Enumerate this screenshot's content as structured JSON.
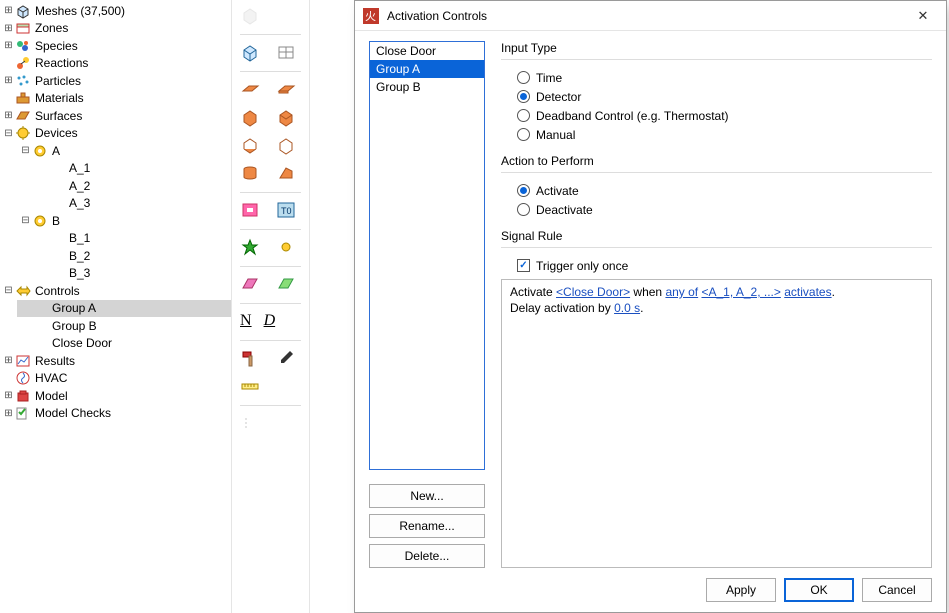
{
  "tree": {
    "meshes": "Meshes (37,500)",
    "zones": "Zones",
    "species": "Species",
    "reactions": "Reactions",
    "particles": "Particles",
    "materials": "Materials",
    "surfaces": "Surfaces",
    "devices": "Devices",
    "dev_a": "A",
    "dev_a1": "A_1",
    "dev_a2": "A_2",
    "dev_a3": "A_3",
    "dev_b": "B",
    "dev_b1": "B_1",
    "dev_b2": "B_2",
    "dev_b3": "B_3",
    "controls": "Controls",
    "ctrl_group_a": "Group A",
    "ctrl_group_b": "Group B",
    "ctrl_close_door": "Close Door",
    "results": "Results",
    "hvac": "HVAC",
    "model": "Model",
    "model_checks": "Model Checks"
  },
  "dialog": {
    "title": "Activation Controls",
    "list_items": [
      "Close Door",
      "Group A",
      "Group B"
    ],
    "selected_index": 1,
    "buttons": {
      "new": "New...",
      "rename": "Rename...",
      "delete": "Delete..."
    },
    "section_input": "Input Type",
    "radios_input": {
      "time": "Time",
      "detector": "Detector",
      "deadband": "Deadband Control (e.g. Thermostat)",
      "manual": "Manual"
    },
    "input_selected": "detector",
    "section_action": "Action to Perform",
    "radios_action": {
      "activate": "Activate",
      "deactivate": "Deactivate"
    },
    "action_selected": "activate",
    "section_signal": "Signal Rule",
    "trigger_once_label": "Trigger only once",
    "trigger_once_checked": true,
    "rule": {
      "prefix": "Activate ",
      "link1": "<Close Door>",
      "mid1": " when ",
      "link2": "any of",
      "mid2": " ",
      "link3": "<A_1, A_2, ...>",
      "mid3": " ",
      "link4": "activates",
      "suffix1": ".",
      "line2a": "Delay activation by ",
      "link5": "0.0 s",
      "suffix2": "."
    },
    "footer": {
      "apply": "Apply",
      "ok": "OK",
      "cancel": "Cancel"
    }
  },
  "toolbar_letters": {
    "n": "N",
    "d": "D"
  }
}
